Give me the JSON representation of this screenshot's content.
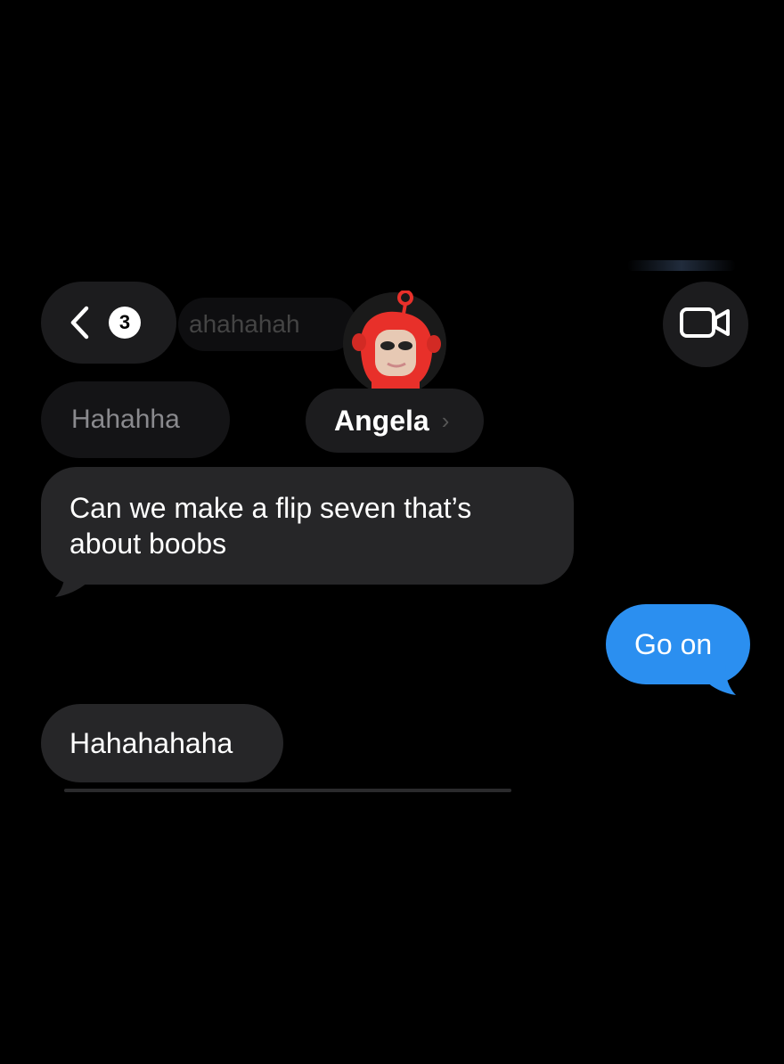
{
  "header": {
    "unread_count": "3",
    "preview_text": "ahahahah",
    "contact_name": "Angela",
    "contact_chevron": "›",
    "back_icon": "chevron-left-icon",
    "video_icon": "video-camera-icon"
  },
  "faded_message": "Hahahha",
  "messages": [
    {
      "direction": "incoming",
      "text": "Can we make a flip seven that’s about boobs"
    },
    {
      "direction": "outgoing",
      "text": "Go on"
    },
    {
      "direction": "incoming",
      "text": "Hahahahaha"
    }
  ],
  "colors": {
    "background": "#000000",
    "incoming_bubble": "#262628",
    "outgoing_bubble": "#2b8ff0",
    "avatar_red": "#e8302a"
  }
}
